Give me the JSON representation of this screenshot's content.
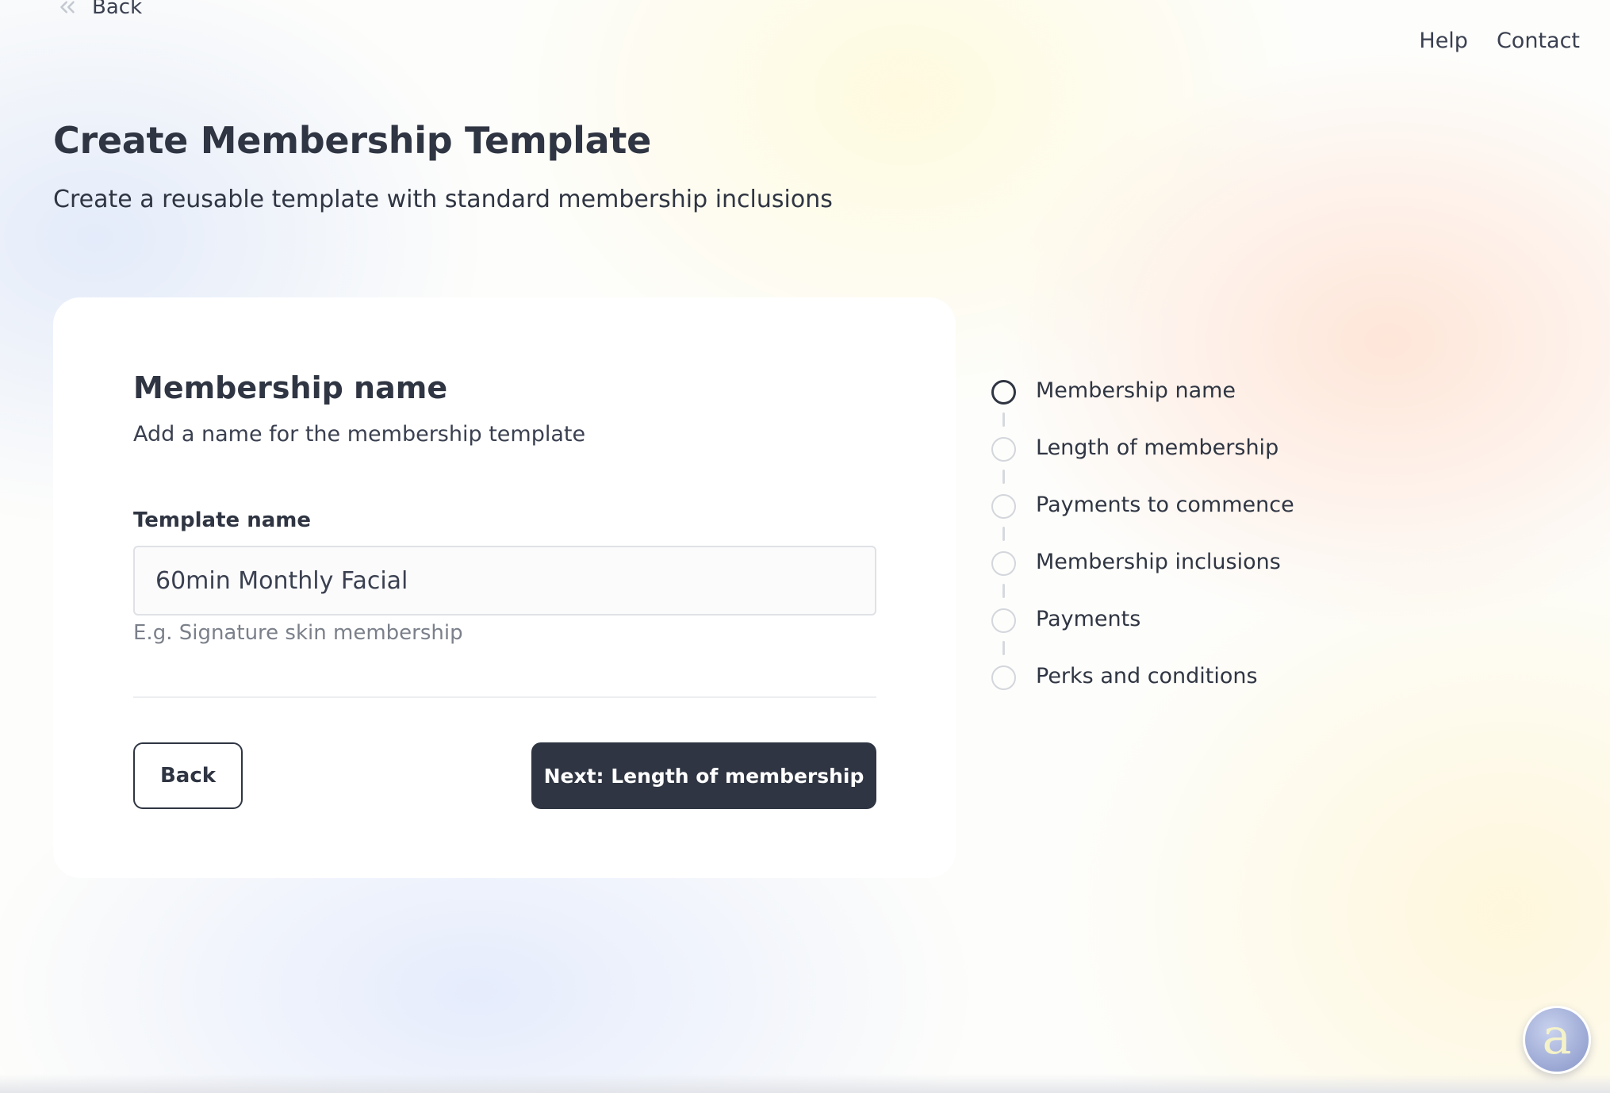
{
  "header": {
    "back_label": "Back",
    "nav": {
      "help": "Help",
      "contact": "Contact"
    }
  },
  "page": {
    "title": "Create Membership Template",
    "subtitle": "Create a reusable template with standard membership inclusions"
  },
  "form": {
    "section_title": "Membership name",
    "section_description": "Add a name for the membership template",
    "field_label": "Template name",
    "field_value": "60min Monthly Facial",
    "field_hint": "E.g. Signature skin membership",
    "back_button": "Back",
    "next_button": "Next: Length of membership"
  },
  "steps": [
    {
      "label": "Membership name",
      "active": true
    },
    {
      "label": "Length of membership",
      "active": false
    },
    {
      "label": "Payments to commence",
      "active": false
    },
    {
      "label": "Membership inclusions",
      "active": false
    },
    {
      "label": "Payments",
      "active": false
    },
    {
      "label": "Perks and conditions",
      "active": false
    }
  ],
  "assistant": {
    "glyph": "a"
  },
  "colors": {
    "primary": "#2f3542",
    "muted_text": "#7b808a",
    "border": "#dfe1e6",
    "step_inactive": "#d3d6dc"
  }
}
